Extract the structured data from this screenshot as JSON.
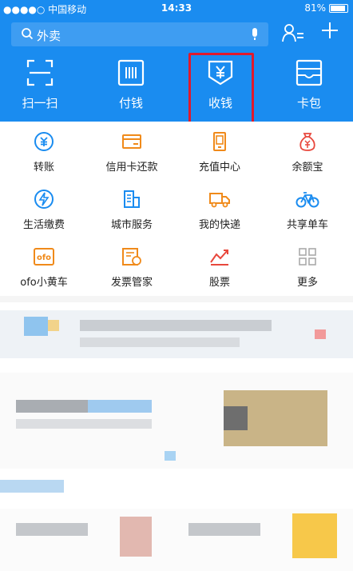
{
  "status": {
    "carrier": "●●●●○ 中国移动",
    "time": "14:33",
    "battery": "81%"
  },
  "header": {
    "search_placeholder": "外卖"
  },
  "top_actions": [
    {
      "label": "扫一扫",
      "icon": "scan-icon"
    },
    {
      "label": "付钱",
      "icon": "barcode-icon"
    },
    {
      "label": "收钱",
      "icon": "receive-money-icon"
    },
    {
      "label": "卡包",
      "icon": "card-wallet-icon"
    }
  ],
  "services": [
    {
      "label": "转账",
      "icon": "transfer-icon",
      "color": "#1a8cf0"
    },
    {
      "label": "信用卡还款",
      "icon": "credit-card-icon",
      "color": "#f08a1a"
    },
    {
      "label": "充值中心",
      "icon": "phone-recharge-icon",
      "color": "#f08a1a"
    },
    {
      "label": "余额宝",
      "icon": "yuebao-bag-icon",
      "color": "#e8473c"
    },
    {
      "label": "生活缴费",
      "icon": "utility-bolt-icon",
      "color": "#1a8cf0"
    },
    {
      "label": "城市服务",
      "icon": "city-building-icon",
      "color": "#1a8cf0"
    },
    {
      "label": "我的快递",
      "icon": "delivery-truck-icon",
      "color": "#f08a1a"
    },
    {
      "label": "共享单车",
      "icon": "bicycle-icon",
      "color": "#1a8cf0"
    },
    {
      "label": "ofo小黄车",
      "icon": "ofo-icon",
      "color": "#f08a1a"
    },
    {
      "label": "发票管家",
      "icon": "invoice-icon",
      "color": "#f08a1a"
    },
    {
      "label": "股票",
      "icon": "stock-chart-icon",
      "color": "#e8473c"
    },
    {
      "label": "更多",
      "icon": "more-grid-icon",
      "color": "#aaaaaa"
    }
  ],
  "colors": {
    "brand_blue": "#1a8cf0",
    "highlight_red": "#e0192c"
  }
}
